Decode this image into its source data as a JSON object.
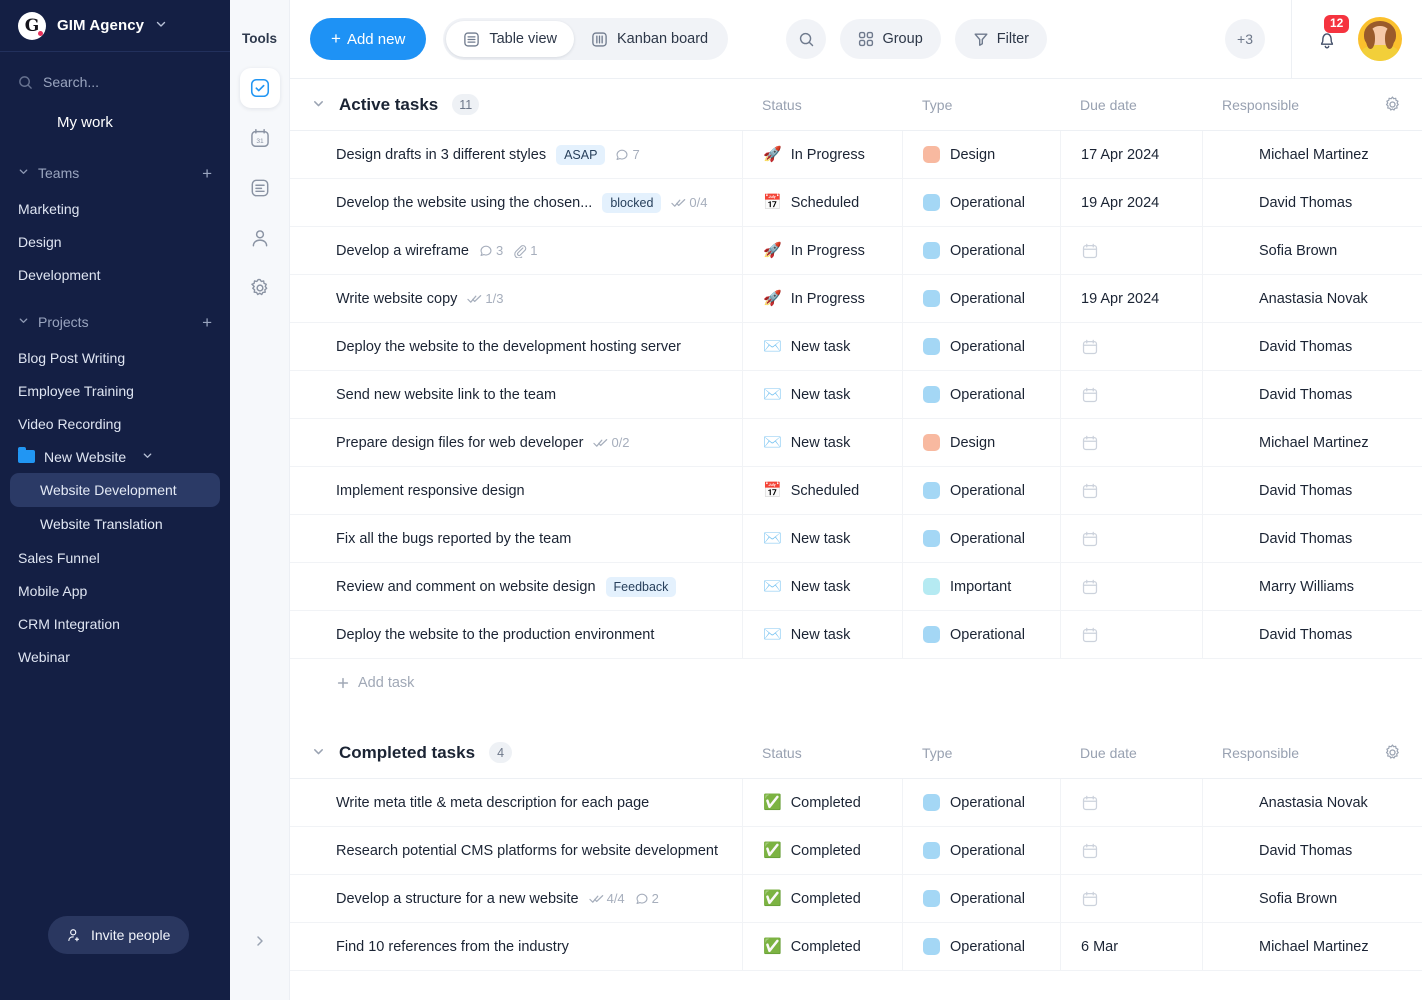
{
  "sidebar": {
    "workspace": {
      "logo_letter": "G",
      "name": "GIM Agency",
      "chevron": "∨"
    },
    "search": {
      "placeholder": "Search...",
      "icon": "search-icon"
    },
    "my_work": "My work",
    "teams": {
      "label": "Teams",
      "add": "+",
      "items": [
        "Marketing",
        "Design",
        "Development"
      ]
    },
    "projects": {
      "label": "Projects",
      "add": "+",
      "items": [
        "Blog Post Writing",
        "Employee Training",
        "Video Recording"
      ],
      "folder": {
        "name": "New Website",
        "chevron": "∨",
        "children": [
          "Website Development",
          "Website Translation"
        ],
        "active_child": "Website Development"
      },
      "after": [
        "Sales Funnel",
        "Mobile App",
        "CRM Integration",
        "Webinar"
      ]
    },
    "invite": "Invite people"
  },
  "rail": {
    "title": "Tools",
    "items": [
      {
        "name": "tasks-icon",
        "active": true
      },
      {
        "name": "calendar-icon",
        "active": false
      },
      {
        "name": "documents-icon",
        "active": false
      },
      {
        "name": "contacts-icon",
        "active": false
      },
      {
        "name": "settings-icon",
        "active": false
      }
    ],
    "expand": "›"
  },
  "topbar": {
    "add_new": "Add new",
    "views": [
      {
        "label": "Table view",
        "icon": "table-icon",
        "active": true
      },
      {
        "label": "Kanban board",
        "icon": "kanban-icon",
        "active": false
      }
    ],
    "search_icon": "search-icon",
    "group": "Group",
    "filter": "Filter",
    "avatars_more": "+3",
    "notifications_count": "12"
  },
  "colors": {
    "accent": "#1e92f5",
    "sidebar_bg": "#141f44",
    "type_design": "#f8b9a0",
    "type_operational": "#a4d7f5",
    "type_important": "#b5eaf2",
    "badge_bg": "#e4f1fd",
    "notification_red": "#f5333f"
  },
  "columns": [
    "Status",
    "Type",
    "Due date",
    "Responsible"
  ],
  "groups": [
    {
      "title": "Active tasks",
      "count": "11",
      "add_task": "Add task",
      "rows": [
        {
          "name": "Design drafts in 3 different styles",
          "tag": "ASAP",
          "comments": "7",
          "status": "In Progress",
          "status_emoji": "🚀",
          "type": "Design",
          "type_color": "#f8b9a0",
          "due": "17 Apr 2024",
          "responsible": "Michael Martinez",
          "av": "michael"
        },
        {
          "name": "Develop the website using the chosen...",
          "tag": "blocked",
          "subtasks": "0/4",
          "status": "Scheduled",
          "status_emoji": "📅",
          "type": "Operational",
          "type_color": "#a4d7f5",
          "due": "19 Apr 2024",
          "responsible": "David Thomas",
          "av": "david"
        },
        {
          "name": "Develop a wireframe",
          "comments": "3",
          "attachments": "1",
          "status": "In Progress",
          "status_emoji": "🚀",
          "type": "Operational",
          "type_color": "#a4d7f5",
          "due": "",
          "responsible": "Sofia Brown",
          "av": "sofia"
        },
        {
          "name": "Write website copy",
          "subtasks": "1/3",
          "status": "In Progress",
          "status_emoji": "🚀",
          "type": "Operational",
          "type_color": "#a4d7f5",
          "due": "19 Apr 2024",
          "responsible": "Anastasia Novak",
          "av": "anastasia"
        },
        {
          "name": "Deploy the website to the development hosting server",
          "status": "New task",
          "status_emoji": "✉️",
          "type": "Operational",
          "type_color": "#a4d7f5",
          "due": "",
          "responsible": "David Thomas",
          "av": "david"
        },
        {
          "name": "Send new website link to the team",
          "status": "New task",
          "status_emoji": "✉️",
          "type": "Operational",
          "type_color": "#a4d7f5",
          "due": "",
          "responsible": "David Thomas",
          "av": "david"
        },
        {
          "name": "Prepare design files for web developer",
          "subtasks": "0/2",
          "status": "New task",
          "status_emoji": "✉️",
          "type": "Design",
          "type_color": "#f8b9a0",
          "due": "",
          "responsible": "Michael Martinez",
          "av": "michael"
        },
        {
          "name": "Implement responsive design",
          "status": "Scheduled",
          "status_emoji": "📅",
          "type": "Operational",
          "type_color": "#a4d7f5",
          "due": "",
          "responsible": "David Thomas",
          "av": "david"
        },
        {
          "name": "Fix all the bugs reported by the team",
          "status": "New task",
          "status_emoji": "✉️",
          "type": "Operational",
          "type_color": "#a4d7f5",
          "due": "",
          "responsible": "David Thomas",
          "av": "david"
        },
        {
          "name": "Review and comment on website design",
          "tag": "Feedback",
          "status": "New task",
          "status_emoji": "✉️",
          "type": "Important",
          "type_color": "#b5eaf2",
          "due": "",
          "responsible": "Marry Williams",
          "av": "marry"
        },
        {
          "name": "Deploy the website to the production environment",
          "status": "New task",
          "status_emoji": "✉️",
          "type": "Operational",
          "type_color": "#a4d7f5",
          "due": "",
          "responsible": "David Thomas",
          "av": "david"
        }
      ]
    },
    {
      "title": "Completed tasks",
      "count": "4",
      "rows": [
        {
          "name": "Write meta title & meta description for each page",
          "status": "Completed",
          "status_emoji": "✅",
          "type": "Operational",
          "type_color": "#a4d7f5",
          "due": "",
          "responsible": "Anastasia Novak",
          "av": "anastasia"
        },
        {
          "name": "Research potential CMS platforms for website development",
          "status": "Completed",
          "status_emoji": "✅",
          "type": "Operational",
          "type_color": "#a4d7f5",
          "due": "",
          "responsible": "David Thomas",
          "av": "david"
        },
        {
          "name": "Develop a structure for a new website",
          "subtasks": "4/4",
          "comments": "2",
          "status": "Completed",
          "status_emoji": "✅",
          "type": "Operational",
          "type_color": "#a4d7f5",
          "due": "",
          "responsible": "Sofia Brown",
          "av": "sofia"
        },
        {
          "name": "Find 10 references from the industry",
          "status": "Completed",
          "status_emoji": "✅",
          "type": "Operational",
          "type_color": "#a4d7f5",
          "due": "6 Mar",
          "responsible": "Michael Martinez",
          "av": "michael"
        }
      ]
    }
  ]
}
